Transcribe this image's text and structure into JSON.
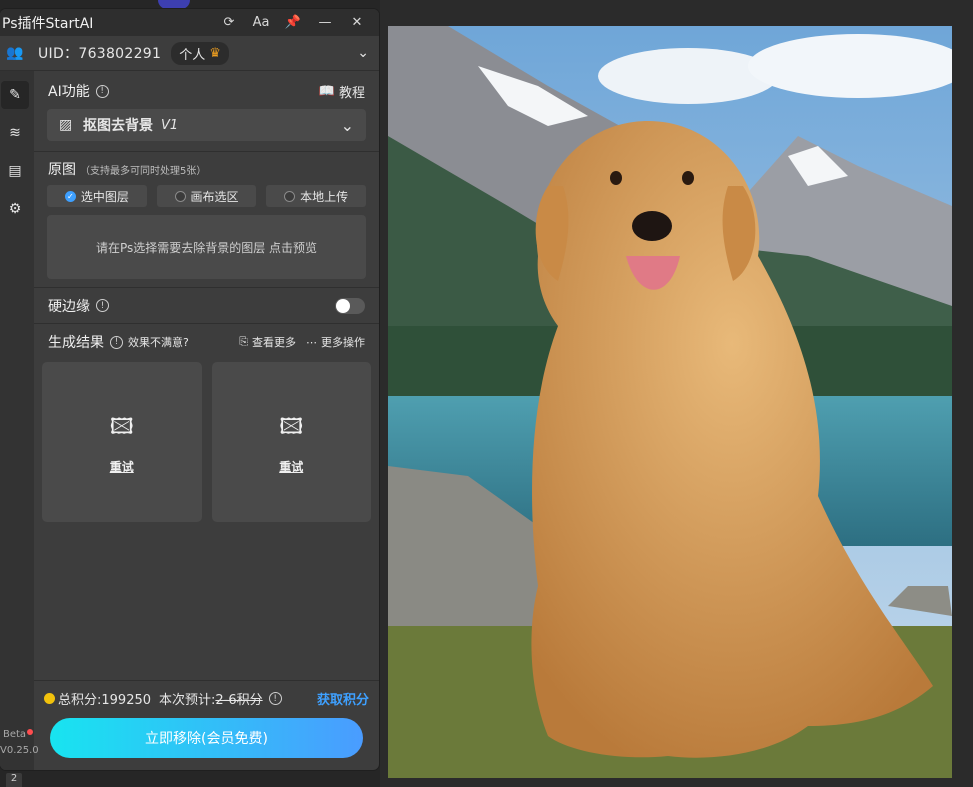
{
  "app": {
    "title": "Ps插件StartAI",
    "titlebar_icons": [
      "refresh-icon",
      "font-size-icon",
      "pin-icon",
      "minimize-icon",
      "close-icon"
    ]
  },
  "user": {
    "uid": "UID：763802291",
    "plan": "个人"
  },
  "rail": {
    "items": [
      "edit-icon",
      "layers-icon",
      "document-icon",
      "gear-icon"
    ],
    "beta": "Beta",
    "version": "V0.25.0"
  },
  "ai": {
    "label": "AI功能",
    "tutorial": "教程",
    "selected": "抠图去背景",
    "selected_version": "V1"
  },
  "source": {
    "label": "原图",
    "hint": "（支持最多可同时处理5张）",
    "options": [
      {
        "label": "选中图层",
        "selected": true
      },
      {
        "label": "画布选区",
        "selected": false
      },
      {
        "label": "本地上传",
        "selected": false
      }
    ],
    "preview_text": "请在Ps选择需要去除背景的图层 点击预览"
  },
  "hard_edge": {
    "label": "硬边缘",
    "enabled": false
  },
  "result": {
    "label": "生成结果",
    "hint": "效果不满意?",
    "view_more": "查看更多",
    "more_actions": "更多操作",
    "cards": [
      {
        "retry": "重试"
      },
      {
        "retry": "重试"
      }
    ]
  },
  "footer": {
    "total": "总积分:199250",
    "estimate_prefix": "本次预计:",
    "estimate_value": "2-6积分",
    "get_points": "获取积分",
    "main_button": "立即移除(会员免费)"
  },
  "bottom_tab": "2",
  "colors": {
    "accent": "#3ea0ff",
    "button_gradient_start": "#18e4f0",
    "button_gradient_end": "#4a9cff",
    "panel_bg": "#3d3d3d"
  }
}
